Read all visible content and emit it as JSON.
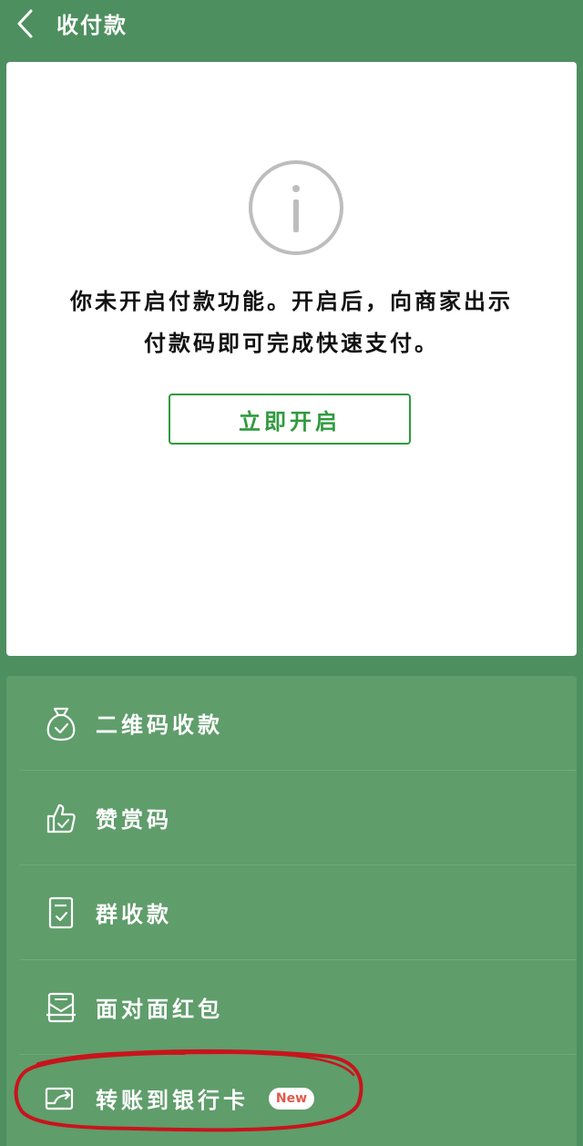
{
  "header": {
    "title": "收付款",
    "back_icon": "chevron-left-icon"
  },
  "card": {
    "icon": "info-circle-icon",
    "message_line1": "你未开启付款功能。开启后，向商家出示",
    "message_line2": "付款码即可完成快速支付。",
    "enable_button": "立即开启",
    "accent_color": "#2f9a3d"
  },
  "menu": {
    "items": [
      {
        "icon": "money-bag-icon",
        "label": "二维码收款"
      },
      {
        "icon": "thumbs-up-icon",
        "label": "赞赏码"
      },
      {
        "icon": "document-list-icon",
        "label": "群收款"
      },
      {
        "icon": "red-packet-icon",
        "label": "面对面红包"
      },
      {
        "icon": "bank-card-transfer-icon",
        "label": "转账到银行卡",
        "badge": "New"
      }
    ]
  },
  "colors": {
    "background": "#4e8f5f",
    "menu_background": "#5f9d6b",
    "highlight": "#c8141c",
    "badge_text": "#e05a4a"
  }
}
